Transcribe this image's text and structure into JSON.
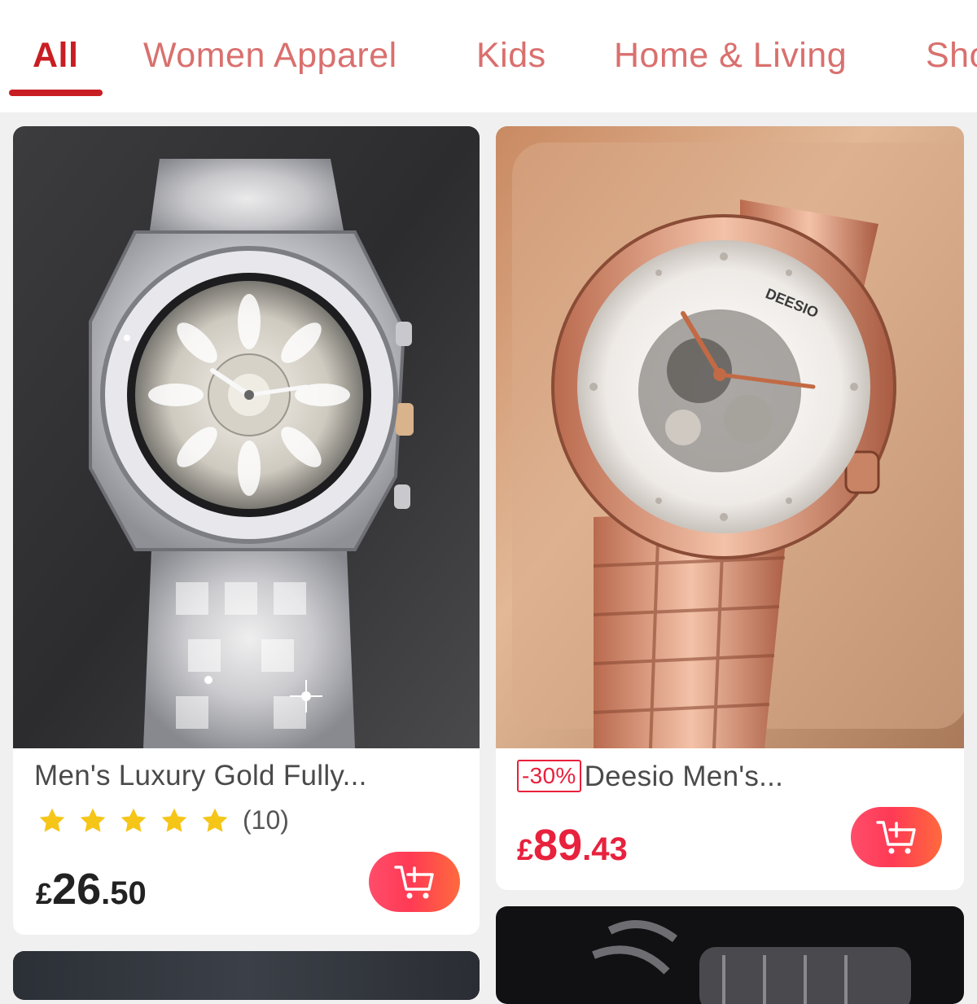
{
  "tabs": [
    {
      "label": "All",
      "active": true
    },
    {
      "label": "Women Apparel",
      "active": false
    },
    {
      "label": "Kids",
      "active": false
    },
    {
      "label": "Home & Living",
      "active": false
    },
    {
      "label": "Sho",
      "active": false
    }
  ],
  "products": [
    {
      "title": "Men's Luxury Gold Fully...",
      "image": "iced-out-silver-watch",
      "rating": 5,
      "review_count": "(10)",
      "price": {
        "currency": "£",
        "integer": "26",
        "decimal": ".50"
      },
      "cart_icon": "add-to-cart-icon"
    },
    {
      "title": "Deesio Men's...",
      "discount": "-30%",
      "image": "rose-gold-skeleton-watch",
      "dial_brand": "DEESIO",
      "price": {
        "currency": "£",
        "integer": "89",
        "decimal": ".43"
      },
      "cart_icon": "add-to-cart-icon"
    }
  ],
  "colors": {
    "accent": "#c81e23",
    "tab_inactive": "#d9706e",
    "price_red": "#e8213d",
    "star": "#f5c518"
  }
}
